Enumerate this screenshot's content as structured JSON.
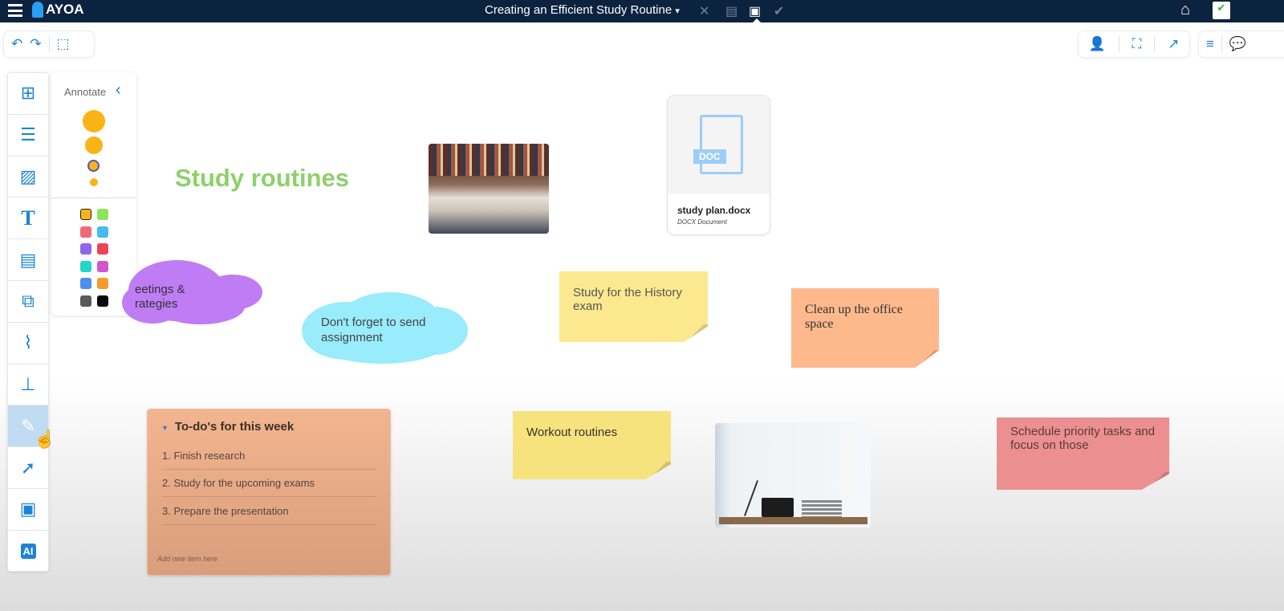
{
  "app": {
    "logo": "AYOA",
    "title": "Creating an Efficient Study Routine",
    "title_caret": "▾"
  },
  "topbar_icons": [
    "mind-map-view-icon",
    "document-view-icon",
    "whiteboard-view-icon",
    "task-view-icon",
    "home-icon",
    "tasks-icon"
  ],
  "tool_icons": [
    "add-sticky-icon",
    "list-icon",
    "image-icon",
    "text-icon",
    "document-icon",
    "widget-icon",
    "attachment-icon",
    "org-chart-icon",
    "pen-icon",
    "arrow-icon",
    "frame-icon",
    "ai-icon"
  ],
  "tools_ai_label": "AI",
  "annotate": {
    "label": "Annotate",
    "back": "‹",
    "sizes": [
      30,
      22,
      15,
      10
    ],
    "colors": [
      "#f9b314",
      "#8ee35b",
      "#f0697a",
      "#45bbef",
      "#9266e8",
      "#ef4356",
      "#23d6c8",
      "#d355cc",
      "#4d8ef1",
      "#f79a2e",
      "#595959",
      "#0a0a0a"
    ]
  },
  "canvas": {
    "heading": "Study routines",
    "doc_card": {
      "filename": "study plan.docx",
      "type": "DOCX Document",
      "badge": "DOC"
    },
    "cloud_purple": "eetings & rategies",
    "cloud_purple_l1": "eetings &",
    "cloud_purple_l2": "rategies",
    "cloud_cyan": "Don't forget to send assignment",
    "sticky_history": "Study for the History exam",
    "sticky_office": "Clean up the office space",
    "sticky_workout": "Workout routines",
    "sticky_schedule": "Schedule priority tasks and focus on those",
    "todo": {
      "title": "To-do's for this week",
      "items": [
        "1.  Finish research",
        "2.  Study for the upcoming exams",
        "3.  Prepare the presentation"
      ],
      "add_placeholder": "Add new item here"
    }
  }
}
